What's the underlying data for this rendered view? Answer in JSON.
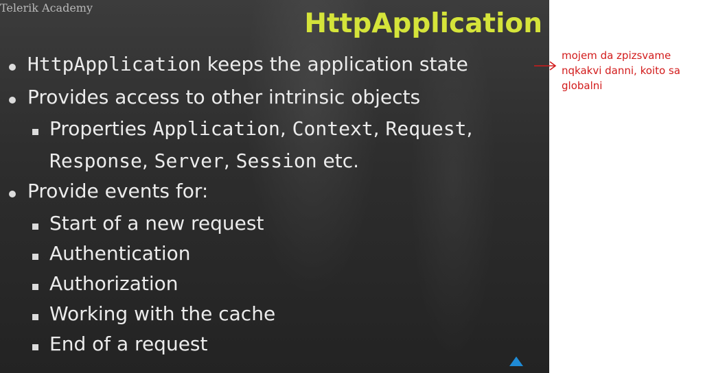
{
  "slide": {
    "logo": "Telerik Academy",
    "title": "HttpApplication",
    "bullets": [
      {
        "level": 1,
        "parts": [
          {
            "text": "HttpApplication",
            "code": true
          },
          {
            "text": " keeps the application state",
            "code": false
          }
        ]
      },
      {
        "level": 1,
        "parts": [
          {
            "text": "Provides access to other intrinsic objects",
            "code": false
          }
        ]
      },
      {
        "level": 2,
        "parts": [
          {
            "text": "Properties ",
            "code": false
          },
          {
            "text": "Application",
            "code": true
          },
          {
            "text": ", ",
            "code": false
          },
          {
            "text": "Context",
            "code": true
          },
          {
            "text": ", ",
            "code": false
          },
          {
            "text": "Request",
            "code": true
          },
          {
            "text": ",",
            "code": false
          }
        ]
      },
      {
        "level": 2,
        "continuation": true,
        "parts": [
          {
            "text": "Response",
            "code": true
          },
          {
            "text": ", ",
            "code": false
          },
          {
            "text": "Server",
            "code": true
          },
          {
            "text": ", ",
            "code": false
          },
          {
            "text": "Session",
            "code": true
          },
          {
            "text": " etc.",
            "code": false
          }
        ]
      },
      {
        "level": 1,
        "parts": [
          {
            "text": "Provide events for:",
            "code": false
          }
        ]
      },
      {
        "level": 2,
        "parts": [
          {
            "text": "Start of a new request",
            "code": false
          }
        ]
      },
      {
        "level": 2,
        "parts": [
          {
            "text": "Authentication",
            "code": false
          }
        ]
      },
      {
        "level": 2,
        "parts": [
          {
            "text": "Authorization",
            "code": false
          }
        ]
      },
      {
        "level": 2,
        "parts": [
          {
            "text": "Working with the cache",
            "code": false
          }
        ]
      },
      {
        "level": 2,
        "parts": [
          {
            "text": "End of a request",
            "code": false
          }
        ]
      }
    ]
  },
  "annotation": {
    "text": "mojem da zpizsvame nqkakvi danni, koito sa globalni",
    "color": "#d21a1a"
  },
  "colors": {
    "title": "#d5e43a",
    "slide_background": "#2e2e2e",
    "nav_accent": "#1f8bd6"
  },
  "icons": [
    "bullet-dot-icon",
    "bullet-square-icon",
    "arrow-right-icon",
    "nav-up-triangle-icon"
  ]
}
